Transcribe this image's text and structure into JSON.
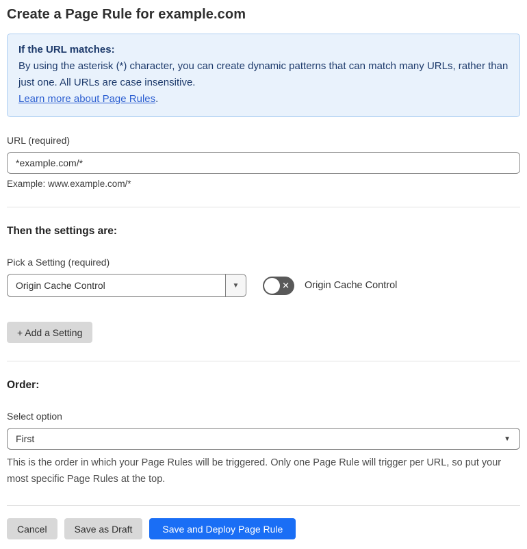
{
  "page": {
    "title": "Create a Page Rule for example.com"
  },
  "info_box": {
    "heading": "If the URL matches:",
    "body": "By using the asterisk (*) character, you can create dynamic patterns that can match many URLs, rather than just one. All URLs are case insensitive.",
    "link_label": "Learn more about Page Rules",
    "link_suffix": "."
  },
  "url_section": {
    "label": "URL (required)",
    "value": "*example.com/*",
    "helper": "Example: www.example.com/*"
  },
  "settings_section": {
    "heading": "Then the settings are:",
    "picker_label": "Pick a Setting (required)",
    "selected_setting": "Origin Cache Control",
    "toggle_label": "Origin Cache Control",
    "toggle_state": "off",
    "add_setting_label": "+ Add a Setting"
  },
  "order_section": {
    "heading": "Order:",
    "select_label": "Select option",
    "selected_option": "First",
    "helper": "This is the order in which your Page Rules will be triggered. Only one Page Rule will trigger per URL, so put your most specific Page Rules at the top."
  },
  "footer": {
    "cancel_label": "Cancel",
    "save_draft_label": "Save as Draft",
    "save_deploy_label": "Save and Deploy Page Rule"
  },
  "icons": {
    "select_chevron": "▼",
    "toggle_x": "✕"
  },
  "colors": {
    "accent_blue": "#1a6ef5",
    "info_bg": "#e9f2fc",
    "info_border": "#aecff2",
    "info_text": "#1d3a6b",
    "link_blue": "#2c5fd1",
    "toggle_off_bg": "#595959",
    "button_gray": "#d8d8d8"
  }
}
